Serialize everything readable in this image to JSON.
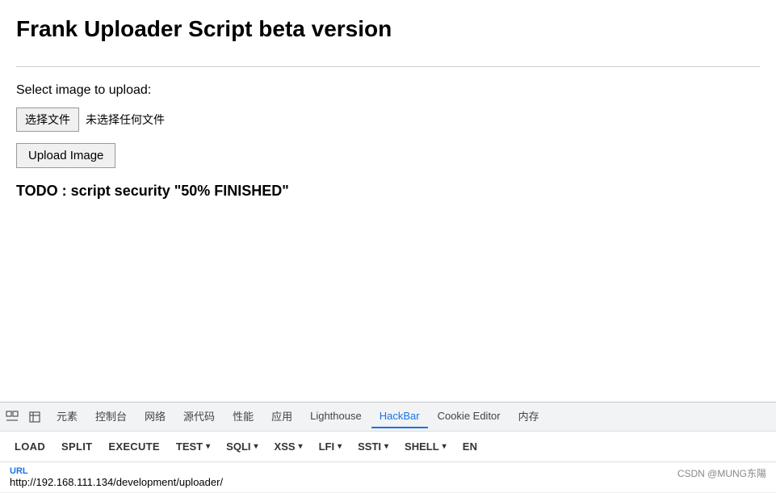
{
  "page": {
    "title": "Frank Uploader Script beta version",
    "select_label": "Select image to upload:",
    "choose_file_btn": "选择文件",
    "no_file_text": "未选择任何文件",
    "upload_btn": "Upload Image",
    "todo_text": "TODO : script security \"50% FINISHED\""
  },
  "devtools": {
    "tab_icons": [
      "cursor-icon",
      "inspector-box-icon"
    ],
    "tabs": [
      {
        "label": "元素",
        "active": false
      },
      {
        "label": "控制台",
        "active": false
      },
      {
        "label": "网络",
        "active": false
      },
      {
        "label": "源代码",
        "active": false
      },
      {
        "label": "性能",
        "active": false
      },
      {
        "label": "应用",
        "active": false
      },
      {
        "label": "Lighthouse",
        "active": false
      },
      {
        "label": "HackBar",
        "active": true
      },
      {
        "label": "Cookie Editor",
        "active": false
      },
      {
        "label": "内存",
        "active": false
      }
    ],
    "toolbar_items": [
      {
        "label": "LOAD",
        "has_dropdown": false
      },
      {
        "label": "SPLIT",
        "has_dropdown": false
      },
      {
        "label": "EXECUTE",
        "has_dropdown": false
      },
      {
        "label": "TEST",
        "has_dropdown": true
      },
      {
        "label": "SQLI",
        "has_dropdown": true
      },
      {
        "label": "XSS",
        "has_dropdown": true
      },
      {
        "label": "LFI",
        "has_dropdown": true
      },
      {
        "label": "SSTI",
        "has_dropdown": true
      },
      {
        "label": "SHELL",
        "has_dropdown": true
      },
      {
        "label": "EN",
        "has_dropdown": false
      }
    ],
    "url_label": "URL",
    "url_value": "http://192.168.111.134/development/uploader/",
    "credit": "CSDN @MUNG东陽"
  }
}
